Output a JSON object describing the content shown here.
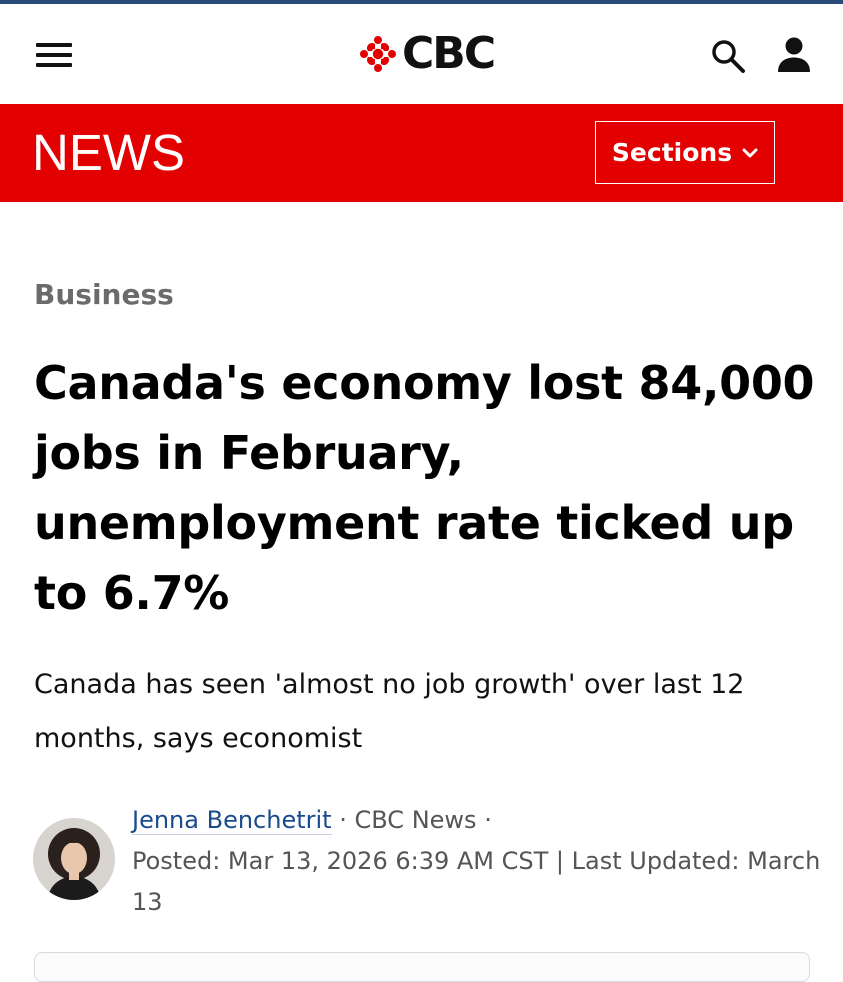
{
  "header": {
    "menu_icon": "hamburger-menu-icon",
    "logo_text": "CBC",
    "logo_icon": "cbc-gem-icon",
    "search_icon": "search-icon",
    "account_icon": "user-icon"
  },
  "newsbar": {
    "title": "NEWS",
    "sections_label": "Sections",
    "sections_icon": "chevron-down-icon"
  },
  "article": {
    "category": "Business",
    "headline": "Canada's economy lost 84,000 jobs in February, unemployment rate ticked up to 6.7%",
    "deck": "Canada has seen 'almost no job growth' over last 12 months, says economist",
    "byline": {
      "author": "Jenna Benchetrit",
      "separator": "·",
      "outlet": "CBC News",
      "posted": "Posted: Mar 13, 2026 6:39 AM CST",
      "divider": "|",
      "updated": "Last Updated: March 13"
    }
  },
  "colors": {
    "cbc_red": "#e20000",
    "link_blue": "#1a4b8c",
    "category_gray": "#6b6b6b",
    "top_line": "#2a4a7a"
  }
}
